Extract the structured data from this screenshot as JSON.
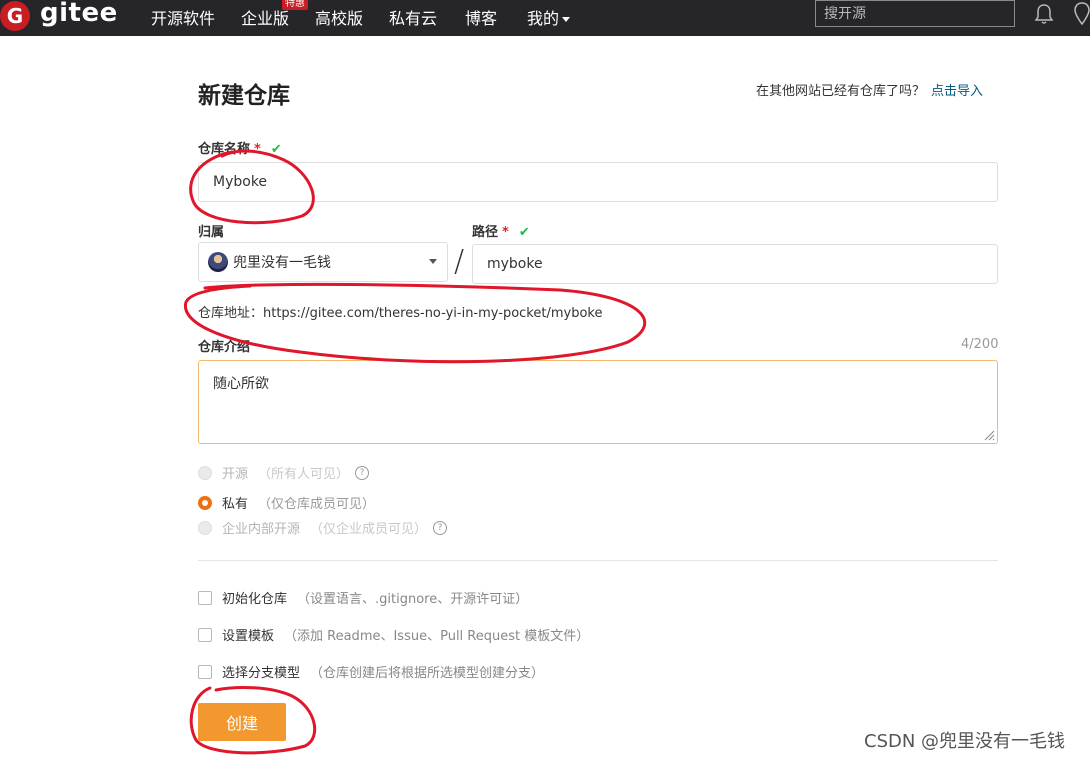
{
  "nav": {
    "logo_glyph": "G",
    "logo_text": "gitee",
    "items": [
      "开源软件",
      "企业版",
      "高校版",
      "私有云",
      "博客"
    ],
    "badge": "特惠",
    "my": "我的",
    "search_placeholder": "搜开源"
  },
  "form": {
    "title": "新建仓库",
    "import_prompt": "在其他网站已经有仓库了吗？",
    "import_link": "点击导入",
    "name_label": "仓库名称",
    "required_mark": "*",
    "valid_mark": "✔",
    "name_value": "Myboke",
    "owner_label": "归属",
    "owner_value": "兜里没有一毛钱",
    "slash": "/",
    "path_label": "路径",
    "path_value": "myboke",
    "address": "仓库地址：https://gitee.com/theres-no-yi-in-my-pocket/myboke",
    "intro_label": "仓库介绍",
    "intro_counter": "4/200",
    "intro_value": "随心所欲",
    "visibility": [
      {
        "label": "开源",
        "hint": "（所有人可见）",
        "selected": false,
        "disabled": true,
        "help": true
      },
      {
        "label": "私有",
        "hint": "（仅仓库成员可见）",
        "selected": true,
        "disabled": false,
        "help": false
      },
      {
        "label": "企业内部开源",
        "hint": "（仅企业成员可见）",
        "selected": false,
        "disabled": true,
        "help": true
      }
    ],
    "options": [
      {
        "label": "初始化仓库",
        "hint": "（设置语言、.gitignore、开源许可证）",
        "checked": false
      },
      {
        "label": "设置模板",
        "hint": "（添加 Readme、Issue、Pull Request 模板文件）",
        "checked": false
      },
      {
        "label": "选择分支模型",
        "hint": "（仓库创建后将根据所选模型创建分支）",
        "checked": false
      }
    ],
    "create_label": "创建"
  },
  "help_glyph": "?",
  "watermark": "CSDN @兜里没有一毛钱",
  "colors": {
    "nav_bg": "#25252a",
    "brand_red": "#c71d23",
    "accent_orange": "#f2982f",
    "link": "#005980",
    "annotation_red": "#e0162b"
  }
}
